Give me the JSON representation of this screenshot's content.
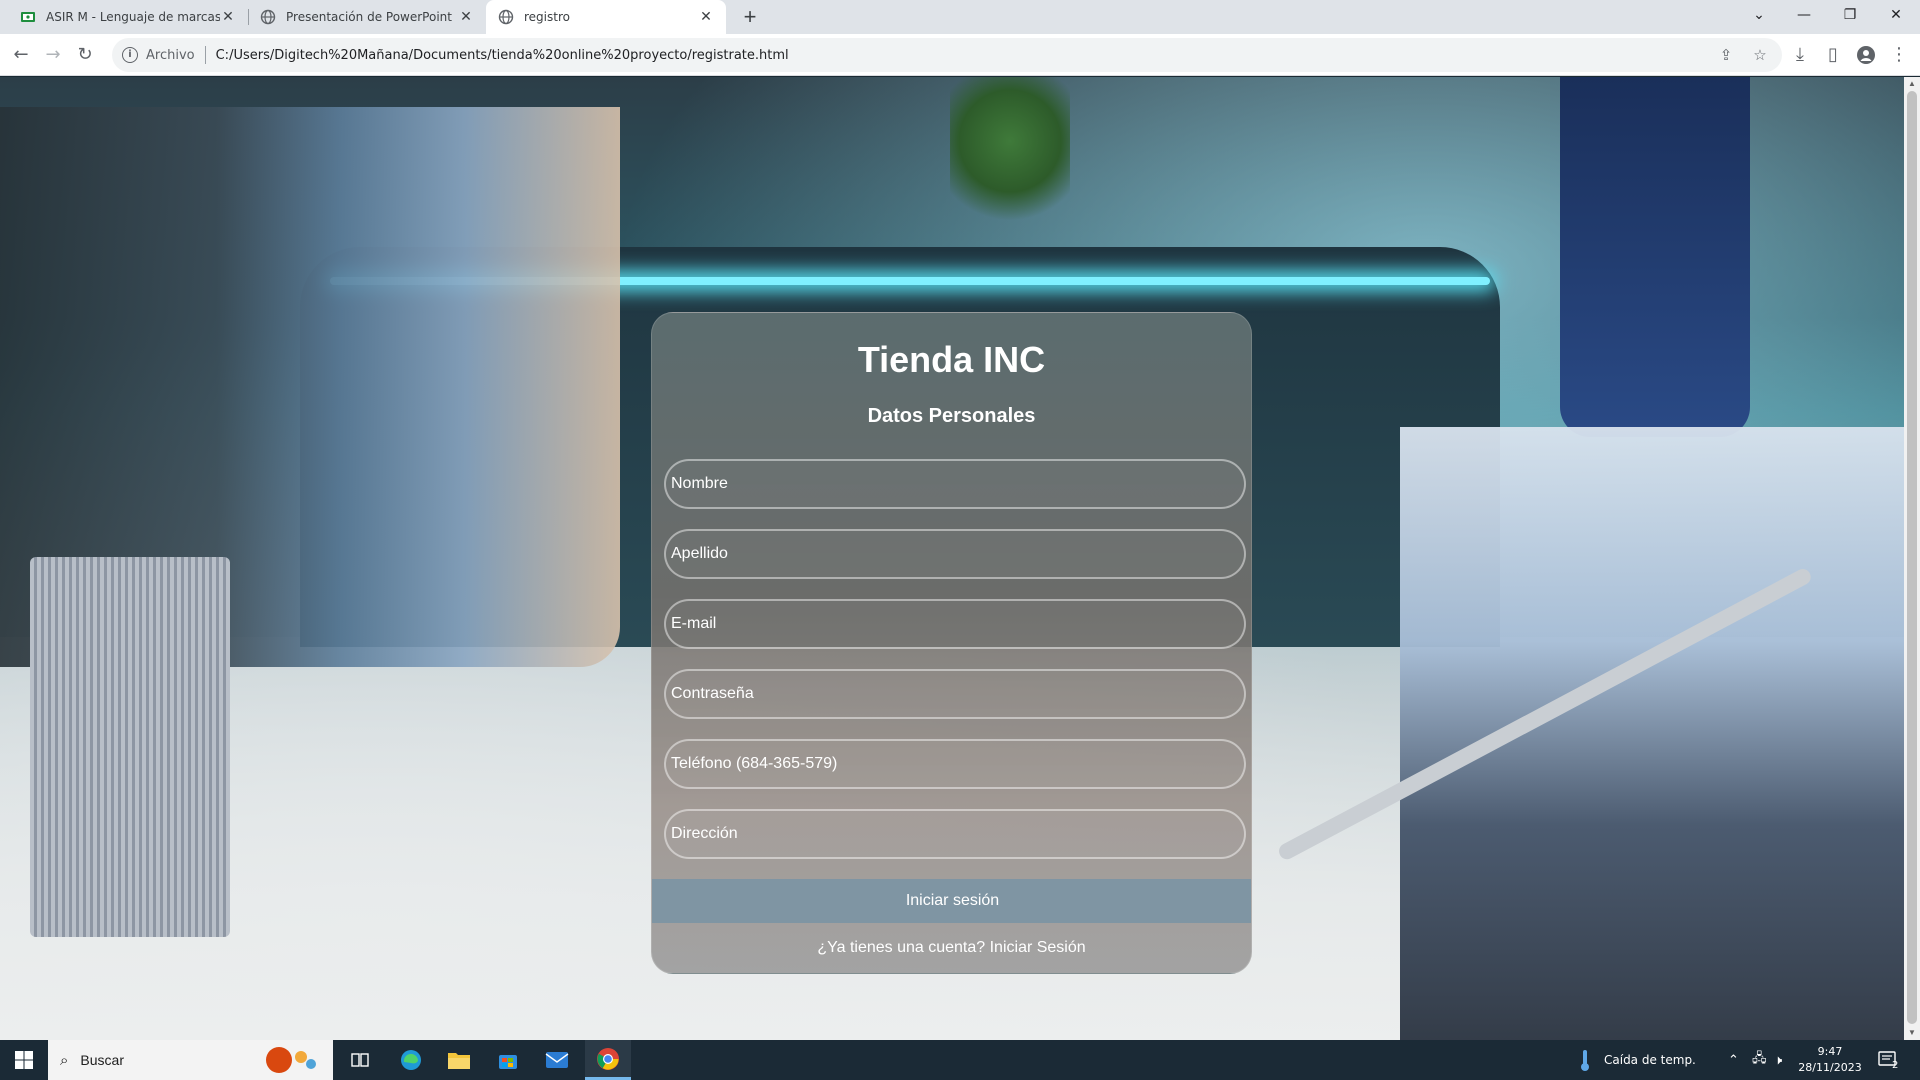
{
  "browser": {
    "tabs": [
      {
        "title": "ASIR M - Lenguaje de marcas y ·",
        "icon": "classroom-icon",
        "active": false
      },
      {
        "title": "Presentación de PowerPoint",
        "icon": "globe-icon",
        "active": false
      },
      {
        "title": "registro",
        "icon": "globe-icon",
        "active": true
      }
    ],
    "address": {
      "scheme_label": "Archivo",
      "url": "C:/Users/Digitech%20Mañana/Documents/tienda%20online%20proyecto/registrate.html"
    }
  },
  "page": {
    "store_title": "Tienda INC",
    "section_title": "Datos Personales",
    "fields": [
      {
        "placeholder": "Nombre"
      },
      {
        "placeholder": "Apellido"
      },
      {
        "placeholder": "E-mail"
      },
      {
        "placeholder": "Contraseña"
      },
      {
        "placeholder": "Teléfono (684-365-579)"
      },
      {
        "placeholder": "Dirección"
      }
    ],
    "submit_label": "Iniciar sesión",
    "login_prompt": "¿Ya tienes una cuenta? Iniciar Sesión"
  },
  "taskbar": {
    "search_label": "Buscar",
    "weather_text": "Caída de temp.",
    "time": "9:47",
    "date": "28/11/2023",
    "notification_count": "2"
  },
  "colors": {
    "submit_bg": "#7f95a3",
    "taskbar_bg": "#1b2a36",
    "tabstrip_bg": "#dfe3e8"
  }
}
